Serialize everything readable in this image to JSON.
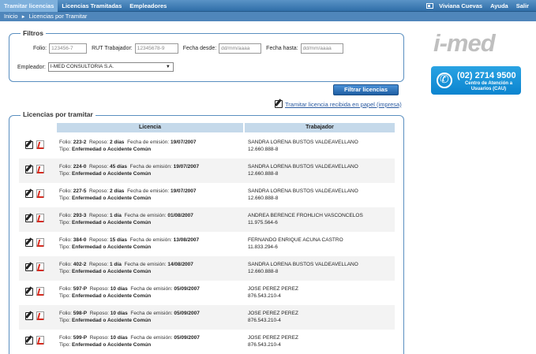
{
  "nav": {
    "items": [
      "Tramitar licencias",
      "Licencias Tramitadas",
      "Empleadores"
    ],
    "active": "Tramitar licencias",
    "user_name": "Viviana Cuevas",
    "ayuda": "Ayuda",
    "salir": "Salir"
  },
  "breadcrumb": {
    "home": "Inicio",
    "sep": "►",
    "current": "Licencias por Tramitar"
  },
  "filtros": {
    "title": "Filtros",
    "folio_label": "Folio:",
    "folio_placeholder": "123456-7",
    "rut_label": "RUT Trabajador:",
    "rut_placeholder": "12345678-9",
    "desde_label": "Fecha desde:",
    "desde_placeholder": "dd/mm/aaaa",
    "hasta_label": "Fecha hasta:",
    "hasta_placeholder": "dd/mm/aaaa",
    "empleador_label": "Empleador:",
    "empleador_value": "I-MED CONSULTORIA S.A.",
    "button": "Filtrar licencias"
  },
  "paper_link": "Tramitar licencia recibida en papel (impresa)",
  "brand": {
    "logo": "i-med",
    "phone": "(02) 2714 9500",
    "cau": "Centro de Atención a Usuarios (CAU)",
    "accent": "#0b84cf"
  },
  "table": {
    "title": "Licencias por tramitar",
    "headers": [
      "Licencia",
      "Trabajador"
    ],
    "labels": {
      "folio": "Folio:",
      "reposo": "Reposo:",
      "emision": "Fecha de emisión:",
      "tipo": "Tipo:"
    },
    "rows": [
      {
        "folio": "223-2",
        "reposo": "2 días",
        "fecha": "19/07/2007",
        "tipo": "Enfermedad o Accidente Común",
        "nombre": "SANDRA LORENA BUSTOS VALDEAVELLANO",
        "rut": "12.660.888-8"
      },
      {
        "folio": "224-0",
        "reposo": "45 días",
        "fecha": "19/07/2007",
        "tipo": "Enfermedad o Accidente Común",
        "nombre": "SANDRA LORENA BUSTOS VALDEAVELLANO",
        "rut": "12.660.888-8"
      },
      {
        "folio": "227-5",
        "reposo": "2 días",
        "fecha": "19/07/2007",
        "tipo": "Enfermedad o Accidente Común",
        "nombre": "SANDRA LORENA BUSTOS VALDEAVELLANO",
        "rut": "12.660.888-8"
      },
      {
        "folio": "293-3",
        "reposo": "1 día",
        "fecha": "01/08/2007",
        "tipo": "Enfermedad o Accidente Común",
        "nombre": "ANDREA BERENCE FROHLICH VASCONCELOS",
        "rut": "11.975.564-6"
      },
      {
        "folio": "384-0",
        "reposo": "15 días",
        "fecha": "13/08/2007",
        "tipo": "Enfermedad o Accidente Común",
        "nombre": "FERNANDO ENRIQUE ACUNA CASTRO",
        "rut": "11.833.294-6"
      },
      {
        "folio": "402-2",
        "reposo": "1 día",
        "fecha": "14/08/2007",
        "tipo": "Enfermedad o Accidente Común",
        "nombre": "SANDRA LORENA BUSTOS VALDEAVELLANO",
        "rut": "12.660.888-8"
      },
      {
        "folio": "597-P",
        "reposo": "10 días",
        "fecha": "05/09/2007",
        "tipo": "Enfermedad o Accidente Común",
        "nombre": "JOSE PEREZ PEREZ",
        "rut": "876.543.210-4"
      },
      {
        "folio": "598-P",
        "reposo": "10 días",
        "fecha": "05/09/2007",
        "tipo": "Enfermedad o Accidente Común",
        "nombre": "JOSE PEREZ PEREZ",
        "rut": "876.543.210-4"
      },
      {
        "folio": "599-P",
        "reposo": "10 días",
        "fecha": "05/09/2007",
        "tipo": "Enfermedad o Accidente Común",
        "nombre": "JOSE PEREZ PEREZ",
        "rut": "876.543.210-4"
      }
    ]
  }
}
